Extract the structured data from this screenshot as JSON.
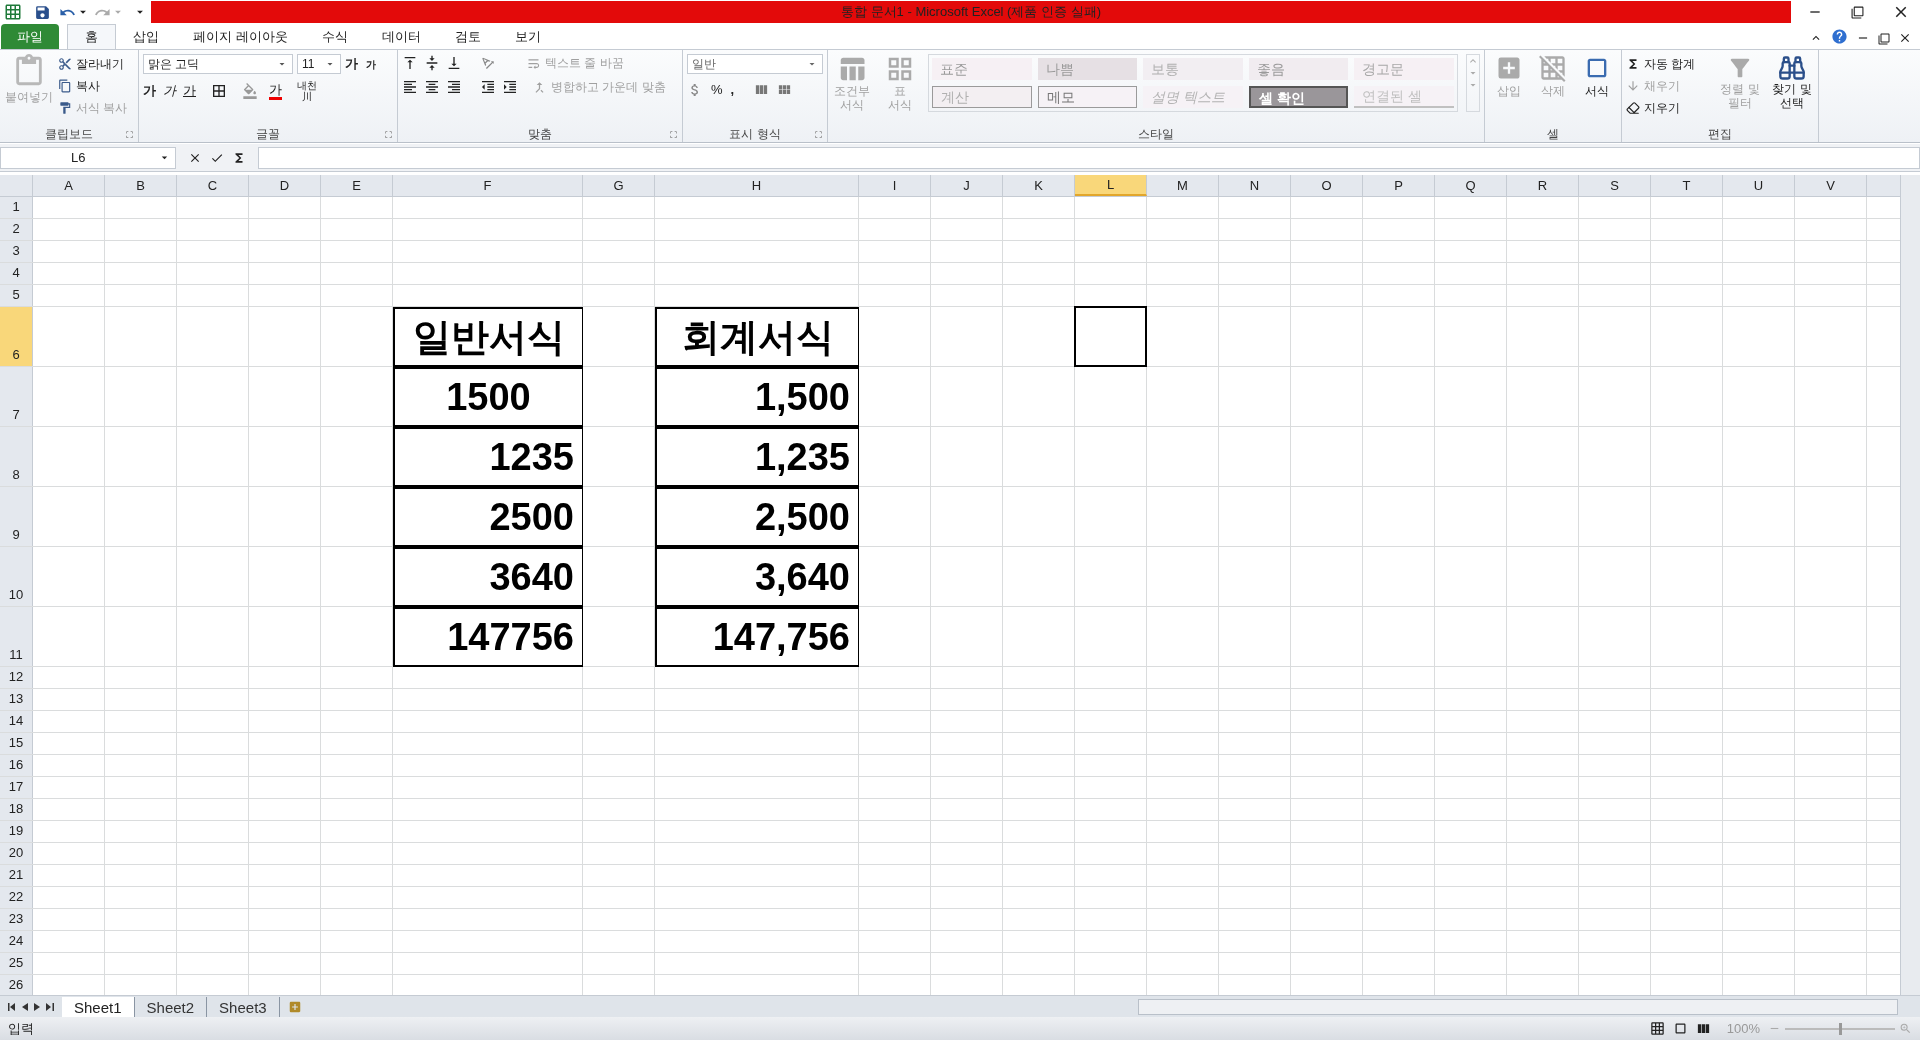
{
  "window": {
    "title": "통합 문서1  -  Microsoft Excel (제품 인증 실패)"
  },
  "ribbon_tabs": [
    {
      "label": "파일",
      "kind": "file",
      "selected": false
    },
    {
      "label": "홈",
      "kind": "tab",
      "selected": true
    },
    {
      "label": "삽입",
      "kind": "tab",
      "selected": false
    },
    {
      "label": "페이지 레이아웃",
      "kind": "tab",
      "selected": false
    },
    {
      "label": "수식",
      "kind": "tab",
      "selected": false
    },
    {
      "label": "데이터",
      "kind": "tab",
      "selected": false
    },
    {
      "label": "검토",
      "kind": "tab",
      "selected": false
    },
    {
      "label": "보기",
      "kind": "tab",
      "selected": false
    }
  ],
  "clipboard": {
    "label": "클립보드",
    "paste": {
      "label": "붙여넣기",
      "disabled": true
    },
    "cut": {
      "label": "잘라내기",
      "disabled": false
    },
    "copy": {
      "label": "복사",
      "disabled": false
    },
    "format_painter": {
      "label": "서식 복사",
      "disabled": true
    }
  },
  "font": {
    "label": "글꼴",
    "font_name": "맑은 고딕",
    "font_size": "11",
    "grow": "가",
    "shrink": "가",
    "bold": "가",
    "italic": "가",
    "underline": "가",
    "font_color": "가",
    "phonetic": [
      "내천",
      "川"
    ]
  },
  "alignment": {
    "label": "맞춤",
    "wrap_text": {
      "label": "텍스트 줄 바꿈",
      "disabled": true
    },
    "merge": {
      "label": "병합하고 가운데 맞춤",
      "disabled": true
    }
  },
  "number": {
    "label": "표시 형식",
    "format": "일반",
    "percent": "%",
    "comma": ","
  },
  "styles": {
    "label": "스타일",
    "conditional": {
      "label": [
        "조건부",
        "서식"
      ],
      "disabled": true
    },
    "table": {
      "label": [
        "표",
        "서식"
      ],
      "disabled": true
    },
    "items": [
      {
        "label": "표준",
        "kind": "normal"
      },
      {
        "label": "나쁨",
        "kind": "bad"
      },
      {
        "label": "보통",
        "kind": "neutral"
      },
      {
        "label": "좋음",
        "kind": "good"
      },
      {
        "label": "경고문",
        "kind": "warning"
      },
      {
        "label": "계산",
        "kind": "calc"
      },
      {
        "label": "메모",
        "kind": "note"
      },
      {
        "label": "설명 텍스트",
        "kind": "explanatory"
      },
      {
        "label": "셀 확인",
        "kind": "check"
      },
      {
        "label": "연결된 셀",
        "kind": "linked"
      }
    ]
  },
  "cells_group": {
    "label": "셀",
    "items": [
      {
        "label": "삽입",
        "disabled": true
      },
      {
        "label": "삭제",
        "disabled": true
      },
      {
        "label": "서식",
        "disabled": false
      }
    ]
  },
  "editing": {
    "label": "편집",
    "autosum": {
      "label": "자동 합계",
      "disabled": false
    },
    "fill": {
      "label": "채우기",
      "disabled": true
    },
    "clear": {
      "label": "지우기",
      "disabled": false
    },
    "sort": {
      "label": [
        "정렬 및",
        "필터"
      ],
      "disabled": true
    },
    "find": {
      "label": [
        "찾기 및",
        "선택"
      ],
      "disabled": false
    }
  },
  "formula_bar": {
    "name_box": "L6"
  },
  "columns": [
    {
      "label": "A",
      "kind": "normal",
      "selected": false
    },
    {
      "label": "B",
      "kind": "normal",
      "selected": false
    },
    {
      "label": "C",
      "kind": "normal",
      "selected": false
    },
    {
      "label": "D",
      "kind": "normal",
      "selected": false
    },
    {
      "label": "E",
      "kind": "normal",
      "selected": false
    },
    {
      "label": "F",
      "kind": "wide",
      "selected": false
    },
    {
      "label": "G",
      "kind": "normal",
      "selected": false
    },
    {
      "label": "H",
      "kind": "wider",
      "selected": false
    },
    {
      "label": "I",
      "kind": "normal",
      "selected": false
    },
    {
      "label": "J",
      "kind": "normal",
      "selected": false
    },
    {
      "label": "K",
      "kind": "normal",
      "selected": false
    },
    {
      "label": "L",
      "kind": "normal",
      "selected": true
    },
    {
      "label": "M",
      "kind": "normal",
      "selected": false
    },
    {
      "label": "N",
      "kind": "normal",
      "selected": false
    },
    {
      "label": "O",
      "kind": "normal",
      "selected": false
    },
    {
      "label": "P",
      "kind": "normal",
      "selected": false
    },
    {
      "label": "Q",
      "kind": "normal",
      "selected": false
    },
    {
      "label": "R",
      "kind": "normal",
      "selected": false
    },
    {
      "label": "S",
      "kind": "normal",
      "selected": false
    },
    {
      "label": "T",
      "kind": "normal",
      "selected": false
    },
    {
      "label": "U",
      "kind": "normal",
      "selected": false
    },
    {
      "label": "V",
      "kind": "normal",
      "selected": false
    }
  ],
  "rows": [
    {
      "label": "1",
      "kind": "normal",
      "selected": false
    },
    {
      "label": "2",
      "kind": "normal",
      "selected": false
    },
    {
      "label": "3",
      "kind": "normal",
      "selected": false
    },
    {
      "label": "4",
      "kind": "normal",
      "selected": false
    },
    {
      "label": "5",
      "kind": "normal",
      "selected": false
    },
    {
      "label": "6",
      "kind": "tall",
      "selected": true
    },
    {
      "label": "7",
      "kind": "tall",
      "selected": false
    },
    {
      "label": "8",
      "kind": "tall",
      "selected": false
    },
    {
      "label": "9",
      "kind": "tall",
      "selected": false
    },
    {
      "label": "10",
      "kind": "tall",
      "selected": false
    },
    {
      "label": "11",
      "kind": "tall",
      "selected": false
    },
    {
      "label": "12",
      "kind": "normal",
      "selected": false
    },
    {
      "label": "13",
      "kind": "normal",
      "selected": false
    },
    {
      "label": "14",
      "kind": "normal",
      "selected": false
    },
    {
      "label": "15",
      "kind": "normal",
      "selected": false
    },
    {
      "label": "16",
      "kind": "normal",
      "selected": false
    },
    {
      "label": "17",
      "kind": "normal",
      "selected": false
    },
    {
      "label": "18",
      "kind": "normal",
      "selected": false
    },
    {
      "label": "19",
      "kind": "normal",
      "selected": false
    },
    {
      "label": "20",
      "kind": "normal",
      "selected": false
    },
    {
      "label": "21",
      "kind": "normal",
      "selected": false
    },
    {
      "label": "22",
      "kind": "normal",
      "selected": false
    },
    {
      "label": "23",
      "kind": "normal",
      "selected": false
    },
    {
      "label": "24",
      "kind": "normal",
      "selected": false
    },
    {
      "label": "25",
      "kind": "normal",
      "selected": false
    },
    {
      "label": "26",
      "kind": "normal",
      "selected": false
    }
  ],
  "tables": [
    {
      "cells": [
        {
          "text": "일반서식",
          "centered": true
        },
        {
          "text": "1500",
          "centered": true
        },
        {
          "text": "1235",
          "centered": false
        },
        {
          "text": "2500",
          "centered": false
        },
        {
          "text": "3640",
          "centered": false
        },
        {
          "text": "147756",
          "centered": false
        }
      ]
    },
    {
      "cells": [
        {
          "text": "회계서식",
          "centered": true
        },
        {
          "text": "1,500",
          "centered": false
        },
        {
          "text": "1,235",
          "centered": false
        },
        {
          "text": "2,500",
          "centered": false
        },
        {
          "text": "3,640",
          "centered": false
        },
        {
          "text": "147,756",
          "centered": false
        }
      ]
    }
  ],
  "sheet_tabs": [
    {
      "label": "Sheet1",
      "selected": true
    },
    {
      "label": "Sheet2",
      "selected": false
    },
    {
      "label": "Sheet3",
      "selected": false
    }
  ],
  "status_bar": {
    "mode": "입력",
    "zoom": "100%",
    "zoom_slider": {
      "level": 0.5
    }
  }
}
